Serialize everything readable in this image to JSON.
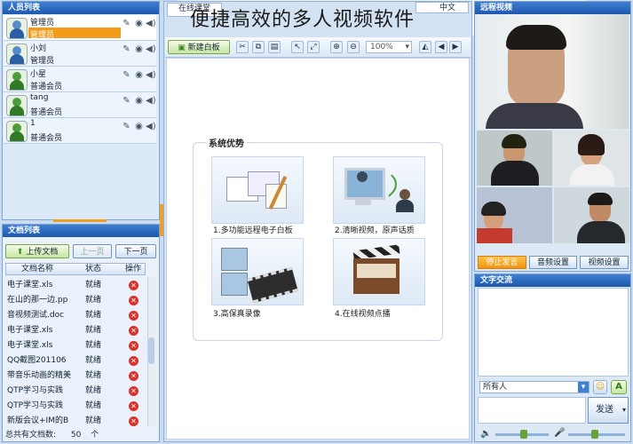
{
  "overlay_title": "便捷高效的多人视频软件",
  "user_panel": {
    "title": "人员列表",
    "users": [
      {
        "name": "管理员",
        "role": "管理员",
        "admin": true,
        "highlight": true
      },
      {
        "name": "小刘",
        "role": "管理员",
        "admin": true,
        "highlight": false
      },
      {
        "name": "小星",
        "role": "普通会员",
        "admin": false,
        "highlight": false
      },
      {
        "name": "tang",
        "role": "普通会员",
        "admin": false,
        "highlight": false
      },
      {
        "name": "1",
        "role": "普通会员",
        "admin": false,
        "highlight": false
      }
    ]
  },
  "doc_panel": {
    "title": "文档列表",
    "upload_label": "上传文档",
    "prev_label": "上一页",
    "next_label": "下一页",
    "columns": [
      "文档名称",
      "状态",
      "操作"
    ],
    "rows": [
      {
        "name": "电子课堂.xls",
        "status": "就绪"
      },
      {
        "name": "在山的那一边.pp",
        "status": "就绪"
      },
      {
        "name": "音视频测试.doc",
        "status": "就绪"
      },
      {
        "name": "电子课堂.xls",
        "status": "就绪"
      },
      {
        "name": "电子课堂.xls",
        "status": "就绪"
      },
      {
        "name": "QQ截图201106",
        "status": "就绪"
      },
      {
        "name": "带音乐动画的精美",
        "status": "就绪"
      },
      {
        "name": "QTP学习与实践",
        "status": "就绪"
      },
      {
        "name": "QTP学习与实践",
        "status": "就绪"
      },
      {
        "name": "新版会议+IM的B",
        "status": "就绪"
      }
    ],
    "total_label": "总共有文档数:",
    "total_count": "50",
    "total_unit": "个"
  },
  "center": {
    "tab_label": "在线课堂",
    "tab_right": "中文",
    "new_whiteboard_label": "新建白板",
    "zoom_value": "100%",
    "features_title": "系统优势",
    "features": [
      {
        "label": "1.多功能远程电子白板",
        "icon": "whiteboard-icon"
      },
      {
        "label": "2.清晰视频，原声话质",
        "icon": "video-call-icon"
      },
      {
        "label": "3.高保真录像",
        "icon": "film-recording-icon"
      },
      {
        "label": "4.在线视频点播",
        "icon": "clapperboard-icon"
      }
    ]
  },
  "video_panel": {
    "title": "远程视频",
    "stop_speaking_label": "停止发言",
    "audio_settings_label": "音频设置",
    "video_settings_label": "视频设置"
  },
  "chat_panel": {
    "title": "文字交流",
    "recipient_value": "所有人",
    "send_label": "发送",
    "font_button": "A"
  },
  "colors": {
    "accent_orange": "#f39b1a",
    "titlebar_blue": "#1d58ae",
    "panel_bg": "#c9dcf1"
  }
}
